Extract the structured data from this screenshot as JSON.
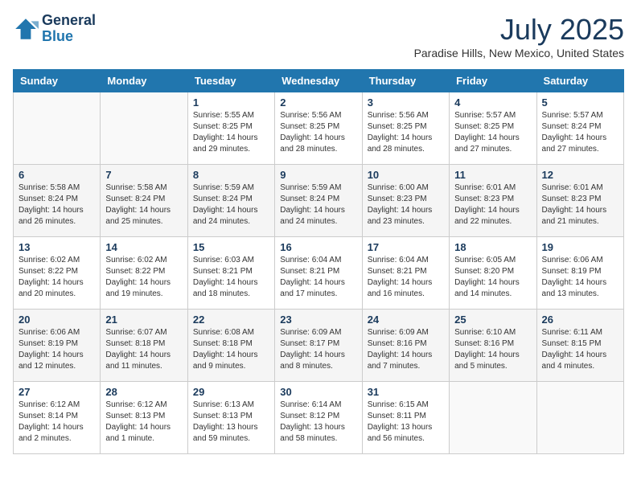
{
  "logo": {
    "line1": "General",
    "line2": "Blue"
  },
  "title": "July 2025",
  "location": "Paradise Hills, New Mexico, United States",
  "days_of_week": [
    "Sunday",
    "Monday",
    "Tuesday",
    "Wednesday",
    "Thursday",
    "Friday",
    "Saturday"
  ],
  "weeks": [
    [
      {
        "day": "",
        "empty": true
      },
      {
        "day": "",
        "empty": true
      },
      {
        "day": "1",
        "sunrise": "Sunrise: 5:55 AM",
        "sunset": "Sunset: 8:25 PM",
        "daylight": "Daylight: 14 hours and 29 minutes."
      },
      {
        "day": "2",
        "sunrise": "Sunrise: 5:56 AM",
        "sunset": "Sunset: 8:25 PM",
        "daylight": "Daylight: 14 hours and 28 minutes."
      },
      {
        "day": "3",
        "sunrise": "Sunrise: 5:56 AM",
        "sunset": "Sunset: 8:25 PM",
        "daylight": "Daylight: 14 hours and 28 minutes."
      },
      {
        "day": "4",
        "sunrise": "Sunrise: 5:57 AM",
        "sunset": "Sunset: 8:25 PM",
        "daylight": "Daylight: 14 hours and 27 minutes."
      },
      {
        "day": "5",
        "sunrise": "Sunrise: 5:57 AM",
        "sunset": "Sunset: 8:24 PM",
        "daylight": "Daylight: 14 hours and 27 minutes."
      }
    ],
    [
      {
        "day": "6",
        "sunrise": "Sunrise: 5:58 AM",
        "sunset": "Sunset: 8:24 PM",
        "daylight": "Daylight: 14 hours and 26 minutes."
      },
      {
        "day": "7",
        "sunrise": "Sunrise: 5:58 AM",
        "sunset": "Sunset: 8:24 PM",
        "daylight": "Daylight: 14 hours and 25 minutes."
      },
      {
        "day": "8",
        "sunrise": "Sunrise: 5:59 AM",
        "sunset": "Sunset: 8:24 PM",
        "daylight": "Daylight: 14 hours and 24 minutes."
      },
      {
        "day": "9",
        "sunrise": "Sunrise: 5:59 AM",
        "sunset": "Sunset: 8:24 PM",
        "daylight": "Daylight: 14 hours and 24 minutes."
      },
      {
        "day": "10",
        "sunrise": "Sunrise: 6:00 AM",
        "sunset": "Sunset: 8:23 PM",
        "daylight": "Daylight: 14 hours and 23 minutes."
      },
      {
        "day": "11",
        "sunrise": "Sunrise: 6:01 AM",
        "sunset": "Sunset: 8:23 PM",
        "daylight": "Daylight: 14 hours and 22 minutes."
      },
      {
        "day": "12",
        "sunrise": "Sunrise: 6:01 AM",
        "sunset": "Sunset: 8:23 PM",
        "daylight": "Daylight: 14 hours and 21 minutes."
      }
    ],
    [
      {
        "day": "13",
        "sunrise": "Sunrise: 6:02 AM",
        "sunset": "Sunset: 8:22 PM",
        "daylight": "Daylight: 14 hours and 20 minutes."
      },
      {
        "day": "14",
        "sunrise": "Sunrise: 6:02 AM",
        "sunset": "Sunset: 8:22 PM",
        "daylight": "Daylight: 14 hours and 19 minutes."
      },
      {
        "day": "15",
        "sunrise": "Sunrise: 6:03 AM",
        "sunset": "Sunset: 8:21 PM",
        "daylight": "Daylight: 14 hours and 18 minutes."
      },
      {
        "day": "16",
        "sunrise": "Sunrise: 6:04 AM",
        "sunset": "Sunset: 8:21 PM",
        "daylight": "Daylight: 14 hours and 17 minutes."
      },
      {
        "day": "17",
        "sunrise": "Sunrise: 6:04 AM",
        "sunset": "Sunset: 8:21 PM",
        "daylight": "Daylight: 14 hours and 16 minutes."
      },
      {
        "day": "18",
        "sunrise": "Sunrise: 6:05 AM",
        "sunset": "Sunset: 8:20 PM",
        "daylight": "Daylight: 14 hours and 14 minutes."
      },
      {
        "day": "19",
        "sunrise": "Sunrise: 6:06 AM",
        "sunset": "Sunset: 8:19 PM",
        "daylight": "Daylight: 14 hours and 13 minutes."
      }
    ],
    [
      {
        "day": "20",
        "sunrise": "Sunrise: 6:06 AM",
        "sunset": "Sunset: 8:19 PM",
        "daylight": "Daylight: 14 hours and 12 minutes."
      },
      {
        "day": "21",
        "sunrise": "Sunrise: 6:07 AM",
        "sunset": "Sunset: 8:18 PM",
        "daylight": "Daylight: 14 hours and 11 minutes."
      },
      {
        "day": "22",
        "sunrise": "Sunrise: 6:08 AM",
        "sunset": "Sunset: 8:18 PM",
        "daylight": "Daylight: 14 hours and 9 minutes."
      },
      {
        "day": "23",
        "sunrise": "Sunrise: 6:09 AM",
        "sunset": "Sunset: 8:17 PM",
        "daylight": "Daylight: 14 hours and 8 minutes."
      },
      {
        "day": "24",
        "sunrise": "Sunrise: 6:09 AM",
        "sunset": "Sunset: 8:16 PM",
        "daylight": "Daylight: 14 hours and 7 minutes."
      },
      {
        "day": "25",
        "sunrise": "Sunrise: 6:10 AM",
        "sunset": "Sunset: 8:16 PM",
        "daylight": "Daylight: 14 hours and 5 minutes."
      },
      {
        "day": "26",
        "sunrise": "Sunrise: 6:11 AM",
        "sunset": "Sunset: 8:15 PM",
        "daylight": "Daylight: 14 hours and 4 minutes."
      }
    ],
    [
      {
        "day": "27",
        "sunrise": "Sunrise: 6:12 AM",
        "sunset": "Sunset: 8:14 PM",
        "daylight": "Daylight: 14 hours and 2 minutes."
      },
      {
        "day": "28",
        "sunrise": "Sunrise: 6:12 AM",
        "sunset": "Sunset: 8:13 PM",
        "daylight": "Daylight: 14 hours and 1 minute."
      },
      {
        "day": "29",
        "sunrise": "Sunrise: 6:13 AM",
        "sunset": "Sunset: 8:13 PM",
        "daylight": "Daylight: 13 hours and 59 minutes."
      },
      {
        "day": "30",
        "sunrise": "Sunrise: 6:14 AM",
        "sunset": "Sunset: 8:12 PM",
        "daylight": "Daylight: 13 hours and 58 minutes."
      },
      {
        "day": "31",
        "sunrise": "Sunrise: 6:15 AM",
        "sunset": "Sunset: 8:11 PM",
        "daylight": "Daylight: 13 hours and 56 minutes."
      },
      {
        "day": "",
        "empty": true
      },
      {
        "day": "",
        "empty": true
      }
    ]
  ]
}
